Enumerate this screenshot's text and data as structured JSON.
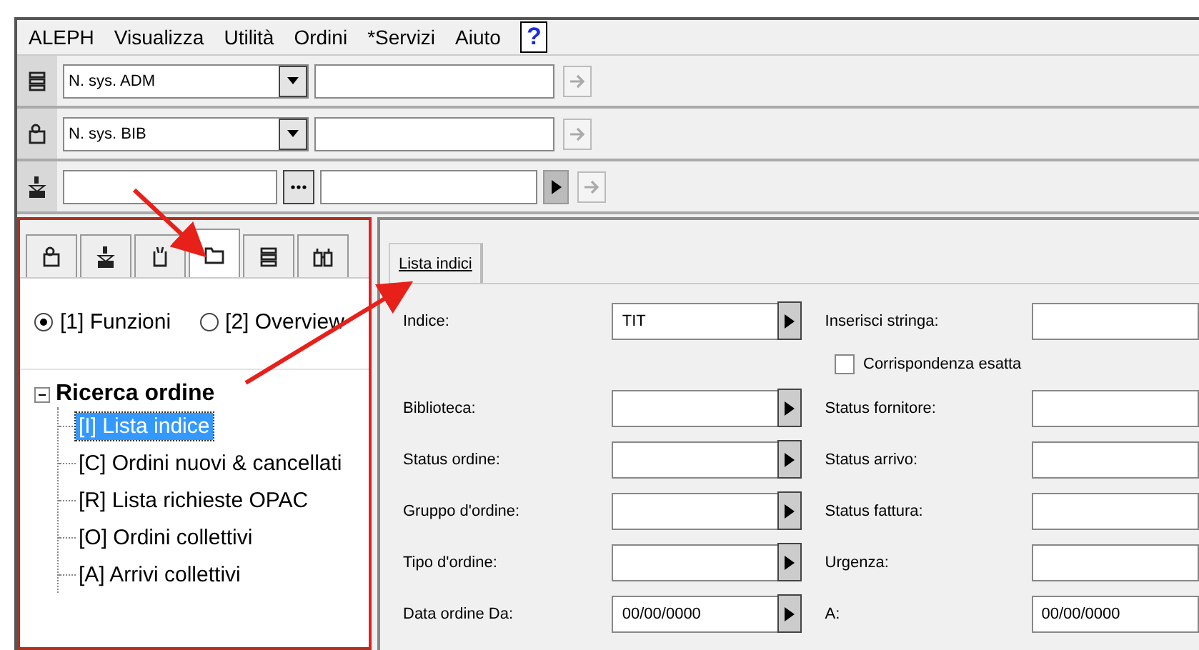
{
  "menu": [
    {
      "label": "ALEPH"
    },
    {
      "label": "Visualizza"
    },
    {
      "label": "Utilità"
    },
    {
      "label": "Ordini"
    },
    {
      "label": "*Servizi"
    },
    {
      "label": "Aiuto"
    }
  ],
  "help": "?",
  "toolbar_rows": [
    {
      "kind": "select",
      "value": "N. sys. ADM"
    },
    {
      "kind": "select",
      "value": "N. sys. BIB"
    },
    {
      "kind": "browse",
      "value": ""
    }
  ],
  "left_tabs": [
    {
      "selected": false
    },
    {
      "selected": false
    },
    {
      "selected": false
    },
    {
      "selected": true
    },
    {
      "selected": false
    },
    {
      "selected": false
    }
  ],
  "radios": [
    {
      "label": "[1] Funzioni",
      "selected": true
    },
    {
      "label": "[2] Overview",
      "selected": false
    }
  ],
  "tree": {
    "label": "Ricerca ordine",
    "expanded": true,
    "children": [
      {
        "label": "[I] Lista indice",
        "selected": true
      },
      {
        "label": "[C] Ordini nuovi & cancellati",
        "selected": false
      },
      {
        "label": "[R] Lista richieste OPAC",
        "selected": false
      },
      {
        "label": "[O] Ordini collettivi",
        "selected": false
      },
      {
        "label": "[A] Arrivi collettivi",
        "selected": false
      }
    ]
  },
  "form_tabs": [
    {
      "label": "Lista indici",
      "selected": true
    }
  ],
  "form_rows": [
    {
      "kind": "fields",
      "left_label": "Indice:",
      "left_value": "TIT",
      "right_label": "Inserisci stringa:",
      "right_value": ""
    },
    {
      "kind": "checkbox",
      "label": "Corrispondenza esatta",
      "checked": false
    },
    {
      "kind": "fields",
      "left_label": "Biblioteca:",
      "left_value": "",
      "right_label": "Status fornitore:",
      "right_value": ""
    },
    {
      "kind": "fields",
      "left_label": "Status ordine:",
      "left_value": "",
      "right_label": "Status arrivo:",
      "right_value": ""
    },
    {
      "kind": "fields",
      "left_label": "Gruppo d'ordine:",
      "left_value": "",
      "right_label": "Status fattura:",
      "right_value": ""
    },
    {
      "kind": "fields",
      "left_label": "Tipo d'ordine:",
      "left_value": "",
      "right_label": "Urgenza:",
      "right_value": ""
    },
    {
      "kind": "fields",
      "left_label": "Data ordine Da:",
      "left_value": "00/00/0000",
      "right_label": "A:",
      "right_value": "00/00/0000"
    }
  ]
}
